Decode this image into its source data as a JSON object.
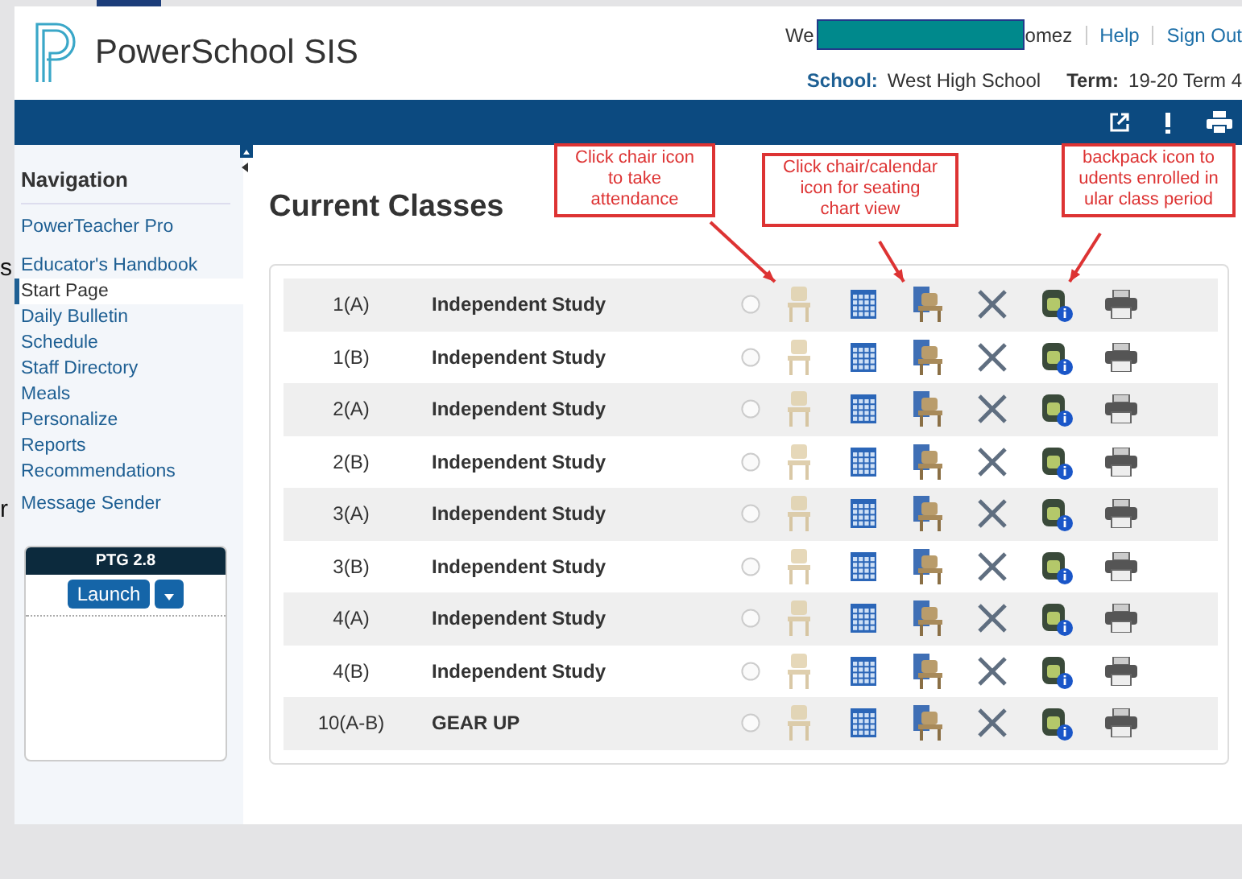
{
  "edge_fragments": [
    "s",
    "r"
  ],
  "header": {
    "product": "PowerSchool SIS",
    "welcome_start": "We",
    "welcome_end": "omez",
    "links": [
      "Help",
      "Sign Out"
    ],
    "school_label": "School:",
    "school": "West High School",
    "term_label": "Term:",
    "term": "19-20 Term 4"
  },
  "sidebar": {
    "title": "Navigation",
    "items": [
      {
        "label": "PowerTeacher Pro",
        "selected": false
      },
      {
        "label": "Educator's Handbook",
        "selected": false
      },
      {
        "label": "Start Page",
        "selected": true
      },
      {
        "label": "Daily Bulletin",
        "selected": false
      },
      {
        "label": "Schedule",
        "selected": false
      },
      {
        "label": "Staff Directory",
        "selected": false
      },
      {
        "label": "Meals",
        "selected": false
      },
      {
        "label": "Personalize",
        "selected": false
      },
      {
        "label": "Reports",
        "selected": false
      },
      {
        "label": "Recommendations",
        "selected": false
      },
      {
        "label": "Message Sender",
        "selected": false
      }
    ],
    "widget": {
      "title": "PTG 2.8",
      "button": "Launch"
    }
  },
  "page_title": "Current Classes",
  "callouts": [
    {
      "lines": [
        "Click chair icon",
        "to take",
        "attendance"
      ]
    },
    {
      "lines": [
        "Click chair/calendar",
        "icon for seating",
        "chart view"
      ]
    },
    {
      "lines": [
        "backpack icon to",
        "udents enrolled in",
        "ular class period"
      ]
    }
  ],
  "classes": [
    {
      "period": "1(A)",
      "course": "Independent Study",
      "selected": false
    },
    {
      "period": "1(B)",
      "course": "Independent Study",
      "selected": false
    },
    {
      "period": "2(A)",
      "course": "Independent Study",
      "selected": false
    },
    {
      "period": "2(B)",
      "course": "Independent Study",
      "selected": false
    },
    {
      "period": "3(A)",
      "course": "Independent Study",
      "selected": false
    },
    {
      "period": "3(B)",
      "course": "Independent Study",
      "selected": false
    },
    {
      "period": "4(A)",
      "course": "Independent Study",
      "selected": false
    },
    {
      "period": "4(B)",
      "course": "Independent Study",
      "selected": false
    },
    {
      "period": "10(A-B)",
      "course": "GEAR UP",
      "selected": false
    }
  ]
}
